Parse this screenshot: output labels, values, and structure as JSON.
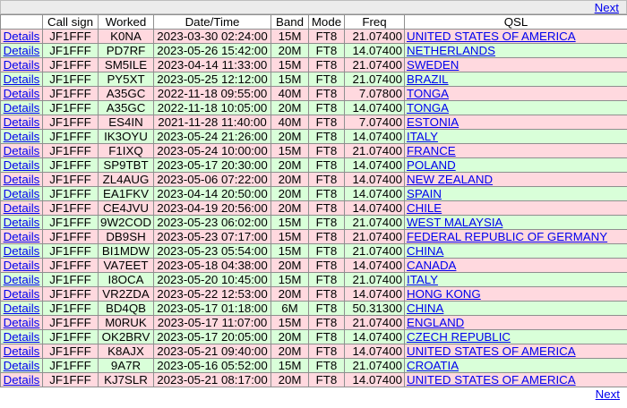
{
  "nav": {
    "next_label": "Next"
  },
  "table": {
    "headers": [
      "",
      "Call sign",
      "Worked",
      "Date/Time",
      "Band",
      "Mode",
      "Freq",
      "QSL"
    ],
    "row_colors": {
      "pink": "#ffd9df",
      "green": "#d9ffd9"
    },
    "rows": [
      {
        "details": "Details",
        "call": "JF1FFF",
        "worked": "K0NA",
        "datetime": "2023-03-30 02:24:00",
        "band": "15M",
        "mode": "FT8",
        "freq": "21.07400",
        "qsl": "UNITED STATES OF AMERICA",
        "color": "pink"
      },
      {
        "details": "Details",
        "call": "JF1FFF",
        "worked": "PD7RF",
        "datetime": "2023-05-26 15:42:00",
        "band": "20M",
        "mode": "FT8",
        "freq": "14.07400",
        "qsl": "NETHERLANDS",
        "color": "green"
      },
      {
        "details": "Details",
        "call": "JF1FFF",
        "worked": "SM5ILE",
        "datetime": "2023-04-14 11:33:00",
        "band": "15M",
        "mode": "FT8",
        "freq": "21.07400",
        "qsl": "SWEDEN",
        "color": "pink"
      },
      {
        "details": "Details",
        "call": "JF1FFF",
        "worked": "PY5XT",
        "datetime": "2023-05-25 12:12:00",
        "band": "15M",
        "mode": "FT8",
        "freq": "21.07400",
        "qsl": "BRAZIL",
        "color": "green"
      },
      {
        "details": "Details",
        "call": "JF1FFF",
        "worked": "A35GC",
        "datetime": "2022-11-18 09:55:00",
        "band": "40M",
        "mode": "FT8",
        "freq": "7.07800",
        "qsl": "TONGA",
        "color": "pink"
      },
      {
        "details": "Details",
        "call": "JF1FFF",
        "worked": "A35GC",
        "datetime": "2022-11-18 10:05:00",
        "band": "20M",
        "mode": "FT8",
        "freq": "14.07400",
        "qsl": "TONGA",
        "color": "green"
      },
      {
        "details": "Details",
        "call": "JF1FFF",
        "worked": "ES4IN",
        "datetime": "2021-11-28 11:40:00",
        "band": "40M",
        "mode": "FT8",
        "freq": "7.07400",
        "qsl": "ESTONIA",
        "color": "pink"
      },
      {
        "details": "Details",
        "call": "JF1FFF",
        "worked": "IK3OYU",
        "datetime": "2023-05-24 21:26:00",
        "band": "20M",
        "mode": "FT8",
        "freq": "14.07400",
        "qsl": "ITALY",
        "color": "green"
      },
      {
        "details": "Details",
        "call": "JF1FFF",
        "worked": "F1IXQ",
        "datetime": "2023-05-24 10:00:00",
        "band": "15M",
        "mode": "FT8",
        "freq": "21.07400",
        "qsl": "FRANCE",
        "color": "pink"
      },
      {
        "details": "Details",
        "call": "JF1FFF",
        "worked": "SP9TBT",
        "datetime": "2023-05-17 20:30:00",
        "band": "20M",
        "mode": "FT8",
        "freq": "14.07400",
        "qsl": "POLAND",
        "color": "green"
      },
      {
        "details": "Details",
        "call": "JF1FFF",
        "worked": "ZL4AUG",
        "datetime": "2023-05-06 07:22:00",
        "band": "20M",
        "mode": "FT8",
        "freq": "14.07400",
        "qsl": "NEW ZEALAND",
        "color": "pink"
      },
      {
        "details": "Details",
        "call": "JF1FFF",
        "worked": "EA1FKV",
        "datetime": "2023-04-14 20:50:00",
        "band": "20M",
        "mode": "FT8",
        "freq": "14.07400",
        "qsl": "SPAIN",
        "color": "green"
      },
      {
        "details": "Details",
        "call": "JF1FFF",
        "worked": "CE4JVU",
        "datetime": "2023-04-19 20:56:00",
        "band": "20M",
        "mode": "FT8",
        "freq": "14.07400",
        "qsl": "CHILE",
        "color": "pink"
      },
      {
        "details": "Details",
        "call": "JF1FFF",
        "worked": "9W2COD",
        "datetime": "2023-05-23 06:02:00",
        "band": "15M",
        "mode": "FT8",
        "freq": "21.07400",
        "qsl": "WEST MALAYSIA",
        "color": "green"
      },
      {
        "details": "Details",
        "call": "JF1FFF",
        "worked": "DB9SH",
        "datetime": "2023-05-23 07:17:00",
        "band": "15M",
        "mode": "FT8",
        "freq": "21.07400",
        "qsl": "FEDERAL REPUBLIC OF GERMANY",
        "color": "pink"
      },
      {
        "details": "Details",
        "call": "JF1FFF",
        "worked": "BI1MDW",
        "datetime": "2023-05-23 05:54:00",
        "band": "15M",
        "mode": "FT8",
        "freq": "21.07400",
        "qsl": "CHINA",
        "color": "green"
      },
      {
        "details": "Details",
        "call": "JF1FFF",
        "worked": "VA7EET",
        "datetime": "2023-05-18 04:38:00",
        "band": "20M",
        "mode": "FT8",
        "freq": "14.07400",
        "qsl": "CANADA",
        "color": "pink"
      },
      {
        "details": "Details",
        "call": "JF1FFF",
        "worked": "I8OCA",
        "datetime": "2023-05-20 10:45:00",
        "band": "15M",
        "mode": "FT8",
        "freq": "21.07400",
        "qsl": "ITALY",
        "color": "green"
      },
      {
        "details": "Details",
        "call": "JF1FFF",
        "worked": "VR2ZDA",
        "datetime": "2023-05-22 12:53:00",
        "band": "20M",
        "mode": "FT8",
        "freq": "14.07400",
        "qsl": "HONG KONG",
        "color": "pink"
      },
      {
        "details": "Details",
        "call": "JF1FFF",
        "worked": "BD4QB",
        "datetime": "2023-05-17 01:18:00",
        "band": "6M",
        "mode": "FT8",
        "freq": "50.31300",
        "qsl": "CHINA",
        "color": "green"
      },
      {
        "details": "Details",
        "call": "JF1FFF",
        "worked": "M0RUK",
        "datetime": "2023-05-17 11:07:00",
        "band": "15M",
        "mode": "FT8",
        "freq": "21.07400",
        "qsl": "ENGLAND",
        "color": "pink"
      },
      {
        "details": "Details",
        "call": "JF1FFF",
        "worked": "OK2BRV",
        "datetime": "2023-05-17 20:05:00",
        "band": "20M",
        "mode": "FT8",
        "freq": "14.07400",
        "qsl": "CZECH REPUBLIC",
        "color": "green"
      },
      {
        "details": "Details",
        "call": "JF1FFF",
        "worked": "K8AJX",
        "datetime": "2023-05-21 09:40:00",
        "band": "20M",
        "mode": "FT8",
        "freq": "14.07400",
        "qsl": "UNITED STATES OF AMERICA",
        "color": "pink"
      },
      {
        "details": "Details",
        "call": "JF1FFF",
        "worked": "9A7R",
        "datetime": "2023-05-16 05:52:00",
        "band": "15M",
        "mode": "FT8",
        "freq": "21.07400",
        "qsl": "CROATIA",
        "color": "green"
      },
      {
        "details": "Details",
        "call": "JF1FFF",
        "worked": "KJ7SLR",
        "datetime": "2023-05-21 08:17:00",
        "band": "20M",
        "mode": "FT8",
        "freq": "14.07400",
        "qsl": "UNITED STATES OF AMERICA",
        "color": "pink"
      }
    ]
  }
}
